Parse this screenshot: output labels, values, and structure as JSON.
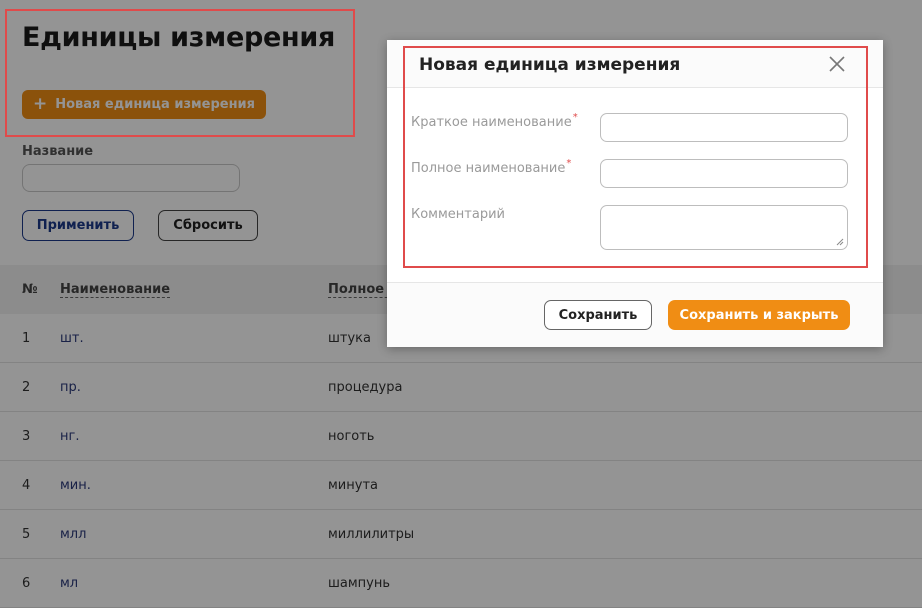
{
  "page": {
    "title": "Единицы измерения",
    "add_button_label": "Новая единица измерения",
    "add_button_icon": "plus-icon",
    "filter": {
      "label": "Название",
      "value": "",
      "apply_label": "Применить",
      "reset_label": "Сбросить"
    }
  },
  "table": {
    "columns": [
      "№",
      "Наименование",
      "Полное н"
    ],
    "rows": [
      {
        "num": "1",
        "name": "шт.",
        "full": "штука"
      },
      {
        "num": "2",
        "name": "пр.",
        "full": "процедура"
      },
      {
        "num": "3",
        "name": "нг.",
        "full": "ноготь"
      },
      {
        "num": "4",
        "name": "мин.",
        "full": "минута"
      },
      {
        "num": "5",
        "name": "млл",
        "full": "миллилитры"
      },
      {
        "num": "6",
        "name": "мл",
        "full": "шампунь"
      }
    ]
  },
  "modal": {
    "title": "Новая единица измерения",
    "close_icon": "close-icon",
    "fields": {
      "short_name": {
        "label": "Краткое наименование",
        "value": "",
        "required": true
      },
      "full_name": {
        "label": "Полное наименование",
        "value": "",
        "required": true
      },
      "comment": {
        "label": "Комментарий",
        "value": "",
        "required": false
      }
    },
    "required_marker": "*",
    "save_label": "Сохранить",
    "save_close_label": "Сохранить и закрыть"
  },
  "colors": {
    "accent": "#f08d14",
    "highlight": "#e04b4b",
    "link": "#2b3a7a",
    "apply_border": "#1d3a8a",
    "overlay": "rgba(0,0,0,0.42)"
  }
}
